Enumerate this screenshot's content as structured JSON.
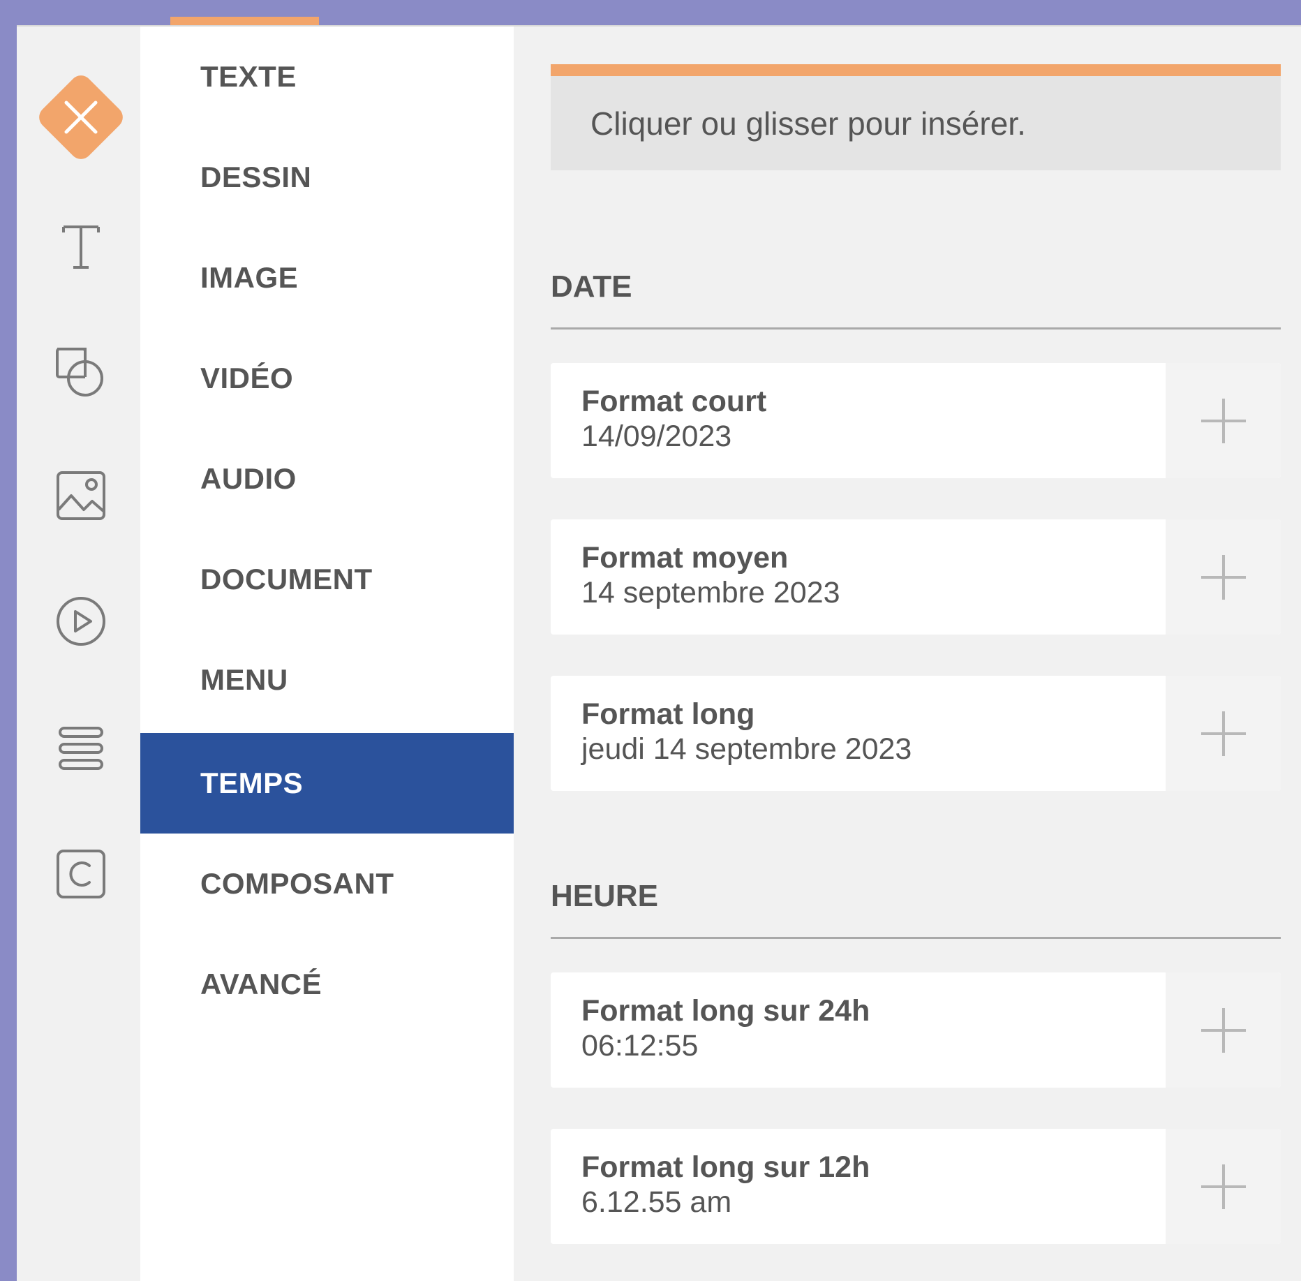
{
  "search": {
    "hint": "Cliquer ou glisser pour insérer."
  },
  "rail": {
    "icons": [
      "close-icon",
      "text-icon",
      "shape-icon",
      "image-icon",
      "video-icon",
      "menu-icon",
      "component-icon"
    ]
  },
  "menu": {
    "items": [
      {
        "label": "TEXTE"
      },
      {
        "label": "DESSIN"
      },
      {
        "label": "IMAGE"
      },
      {
        "label": "VIDÉO"
      },
      {
        "label": "AUDIO"
      },
      {
        "label": "DOCUMENT"
      },
      {
        "label": "MENU"
      },
      {
        "label": "TEMPS"
      },
      {
        "label": "COMPOSANT"
      },
      {
        "label": "AVANCÉ"
      }
    ],
    "active": "TEMPS"
  },
  "sections": {
    "date": {
      "title": "DATE",
      "cards": [
        {
          "name": "Format court",
          "sample": "14/09/2023"
        },
        {
          "name": "Format moyen",
          "sample": "14 septembre 2023"
        },
        {
          "name": "Format long",
          "sample": "jeudi 14 septembre 2023"
        }
      ]
    },
    "time": {
      "title": "HEURE",
      "cards": [
        {
          "name": "Format long sur 24h",
          "sample": "06:12:55"
        },
        {
          "name": "Format long sur 12h",
          "sample": "6.12.55 am"
        }
      ]
    }
  },
  "colors": {
    "accent": "#f2a56b",
    "active": "#2b529c",
    "frame": "#8a8bc6"
  }
}
